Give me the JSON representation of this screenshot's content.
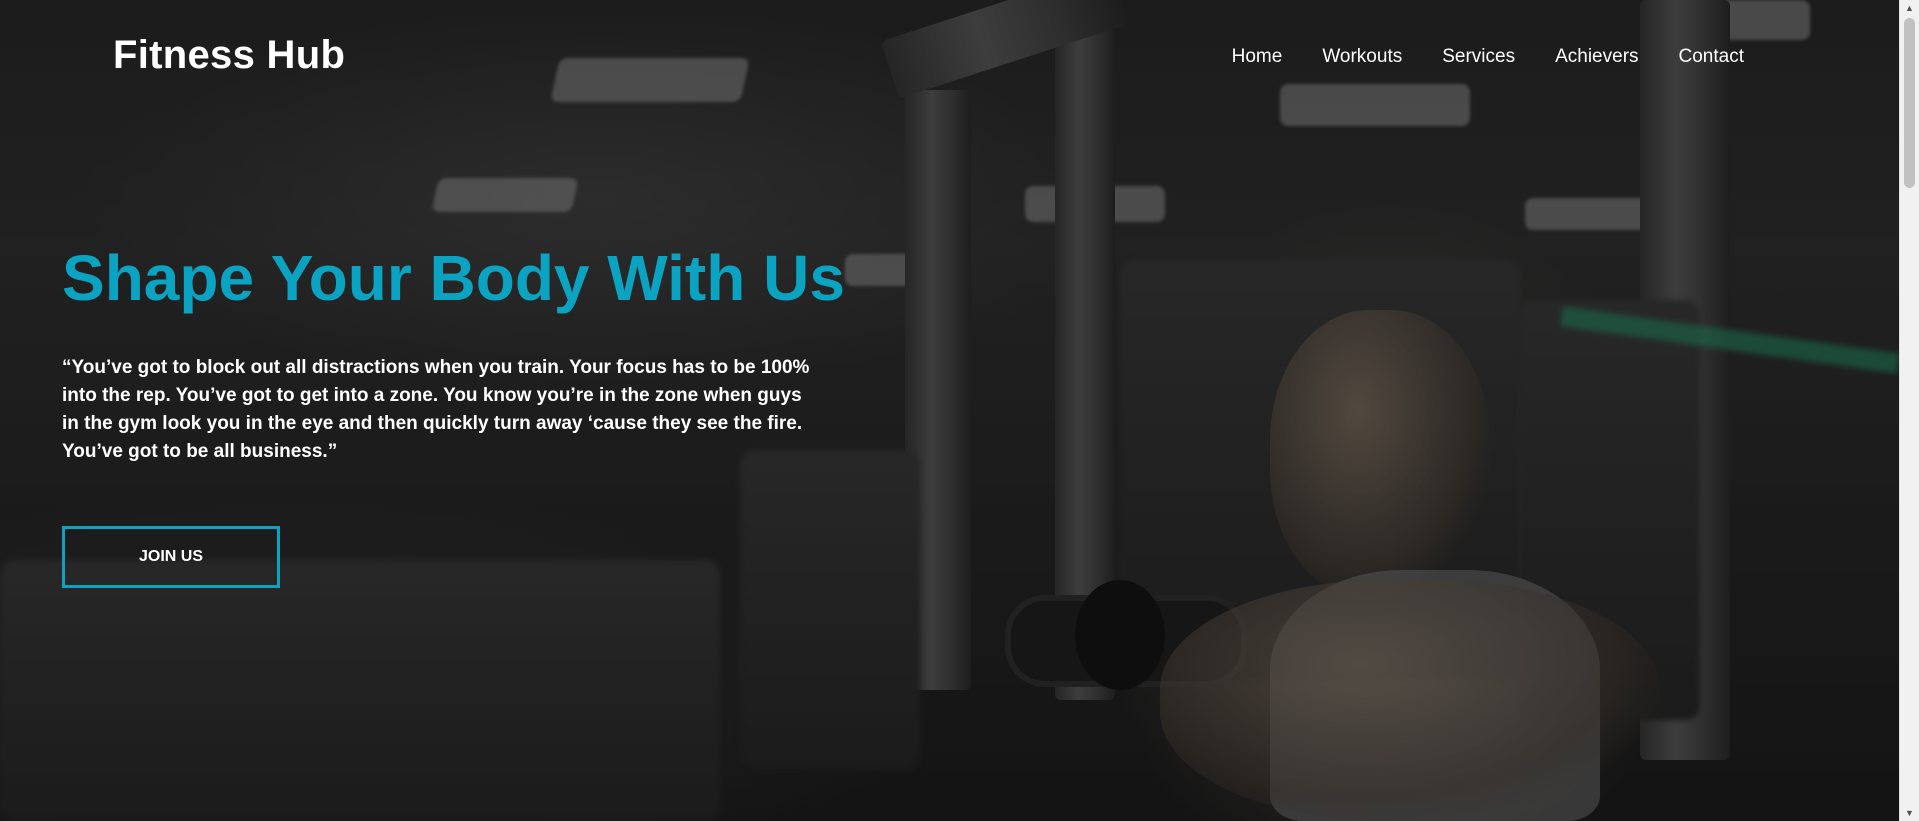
{
  "brand": {
    "name": "Fitness Hub"
  },
  "nav": {
    "items": [
      {
        "label": "Home"
      },
      {
        "label": "Workouts"
      },
      {
        "label": "Services"
      },
      {
        "label": "Achievers"
      },
      {
        "label": "Contact"
      }
    ]
  },
  "hero": {
    "title": "Shape Your Body With Us",
    "quote": "“You’ve got to block out all distractions when you train. Your focus has to be 100% into the rep. You’ve got to get into a zone. You know you’re in the zone when guys in the gym look you in the eye and then quickly turn away ‘cause they see the fire. You’ve got to be all business.”",
    "cta_label": "JOIN US",
    "background_description": "gym-photo-man-on-chest-press-machine"
  },
  "colors": {
    "accent": "#0aa3c2",
    "text": "#ffffff",
    "overlay": "#000000"
  },
  "icons": {
    "scroll_up": "chevron-up-icon",
    "scroll_down": "chevron-down-icon"
  }
}
